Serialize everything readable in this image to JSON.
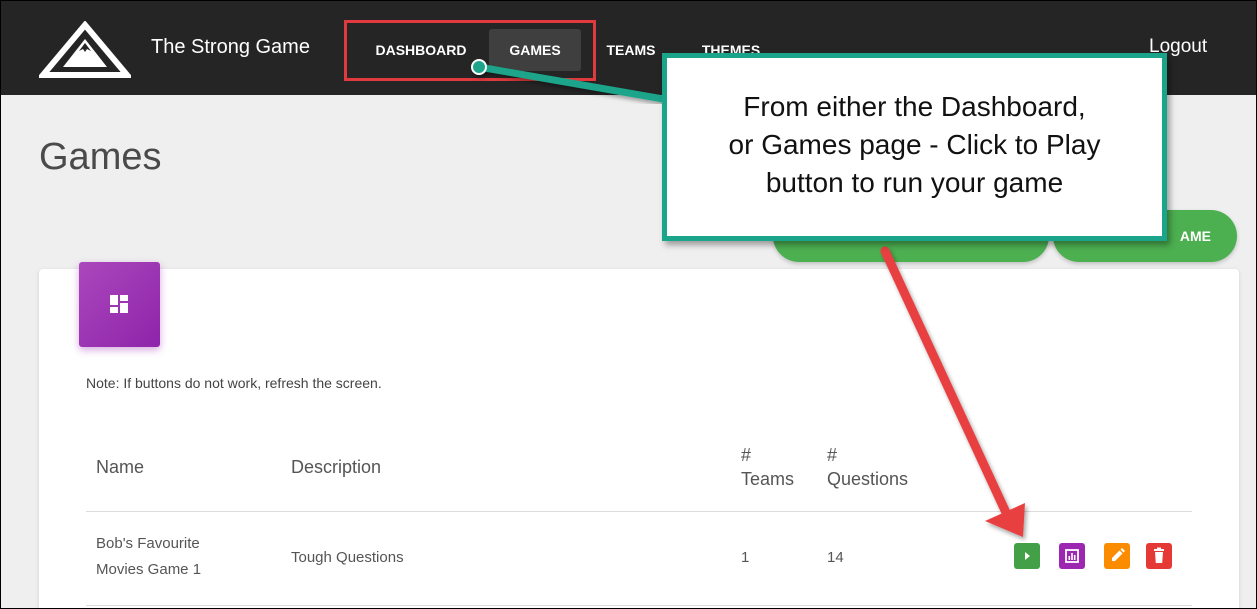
{
  "app": {
    "brand": "The Strong Game",
    "logout_label": "Logout"
  },
  "nav": {
    "items": [
      {
        "label": "DASHBOARD"
      },
      {
        "label": "GAMES"
      },
      {
        "label": "TEAMS"
      },
      {
        "label": "THEMES"
      }
    ]
  },
  "page": {
    "title": "Games",
    "button_2_label": "AME",
    "note": "Note: If buttons do not work, refresh the screen."
  },
  "table": {
    "headers": {
      "name": "Name",
      "description": "Description",
      "teams_line1": "#",
      "teams_line2": "Teams",
      "questions_line1": "#",
      "questions_line2": "Questions"
    },
    "rows": [
      {
        "name_line1": "Bob's Favourite",
        "name_line2": "Movies Game 1",
        "description": "Tough Questions",
        "teams": "1",
        "questions": "14"
      }
    ]
  },
  "callout": {
    "line1": "From either the Dashboard,",
    "line2": "or Games page - Click to Play",
    "line3": "button to run your game"
  },
  "icons": {
    "logo": "mountain-logo-icon",
    "card": "dashboard-grid-icon",
    "play": "play-icon",
    "stats": "bar-chart-icon",
    "edit": "pencil-icon",
    "delete": "trash-icon"
  },
  "colors": {
    "navbar": "#252525",
    "callout_border": "#1aa58b",
    "annotation": "#e03a3e",
    "play": "#43a047",
    "stats": "#9c27b0",
    "edit": "#fb8c00",
    "delete": "#e53935",
    "primary_button": "#4caf50"
  }
}
